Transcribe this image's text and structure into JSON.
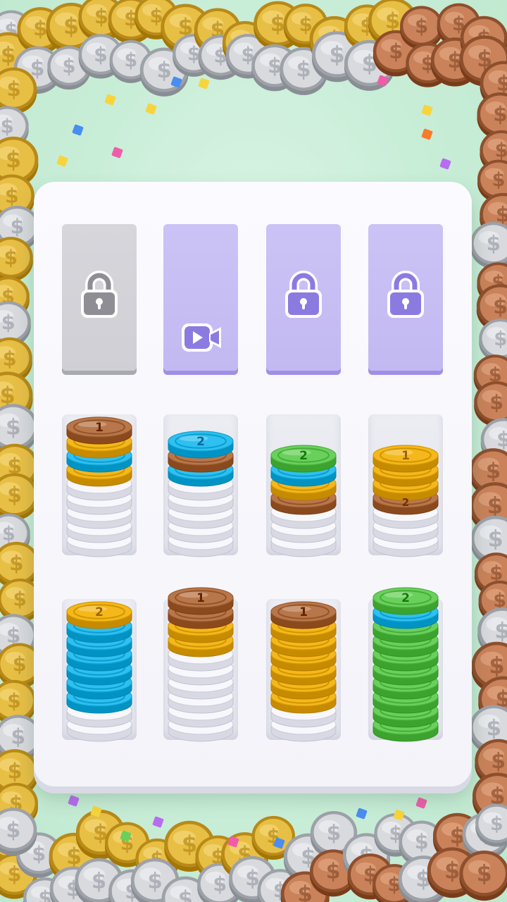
{
  "colors": {
    "background": "#cdeedb",
    "board": "#f6f6fb",
    "locked_grey": "#d3d3d8",
    "locked_purple": "#c6bdf4",
    "icon_purple": "#8b7be0",
    "icon_grey": "#8e8e94",
    "coin_brown": "#b8774a",
    "coin_yellow": "#f4b81c",
    "coin_blue": "#2ec0f0",
    "coin_green": "#6ad05c",
    "coin_white": "#f2f2f8"
  },
  "locked_slots": [
    {
      "style": "grey",
      "icon": "lock-icon"
    },
    {
      "style": "purple",
      "icon": "video-ad-icon"
    },
    {
      "style": "purple",
      "icon": "lock-icon"
    },
    {
      "style": "purple",
      "icon": "lock-icon"
    }
  ],
  "stacks": [
    {
      "white": 5,
      "coins": [
        "yellow",
        "blue",
        "yellow",
        "brown"
      ],
      "top_label": "1"
    },
    {
      "white": 5,
      "coins": [
        "blue",
        "brown",
        "blue"
      ],
      "top_label": "2"
    },
    {
      "white": 3,
      "coins": [
        "brown",
        "yellow",
        "blue",
        "green"
      ],
      "top_label": "2"
    },
    {
      "white": 3,
      "coins": [
        "brown",
        "yellow",
        "yellow",
        "yellow"
      ],
      "top_label": "1",
      "hidden_label": "2"
    },
    {
      "white": 2,
      "coins": [
        "blue",
        "blue",
        "blue",
        "blue",
        "blue",
        "blue",
        "yellow"
      ],
      "top_label": "2"
    },
    {
      "white": 6,
      "coins": [
        "yellow",
        "yellow",
        "brown",
        "brown"
      ],
      "top_label": "1"
    },
    {
      "white": 2,
      "coins": [
        "yellow",
        "yellow",
        "yellow",
        "yellow",
        "yellow",
        "yellow",
        "brown"
      ],
      "top_label": "1"
    },
    {
      "white": 0,
      "coins": [
        "green",
        "green",
        "green",
        "green",
        "green",
        "green",
        "green",
        "green",
        "blue",
        "green"
      ],
      "top_label": "2"
    }
  ]
}
